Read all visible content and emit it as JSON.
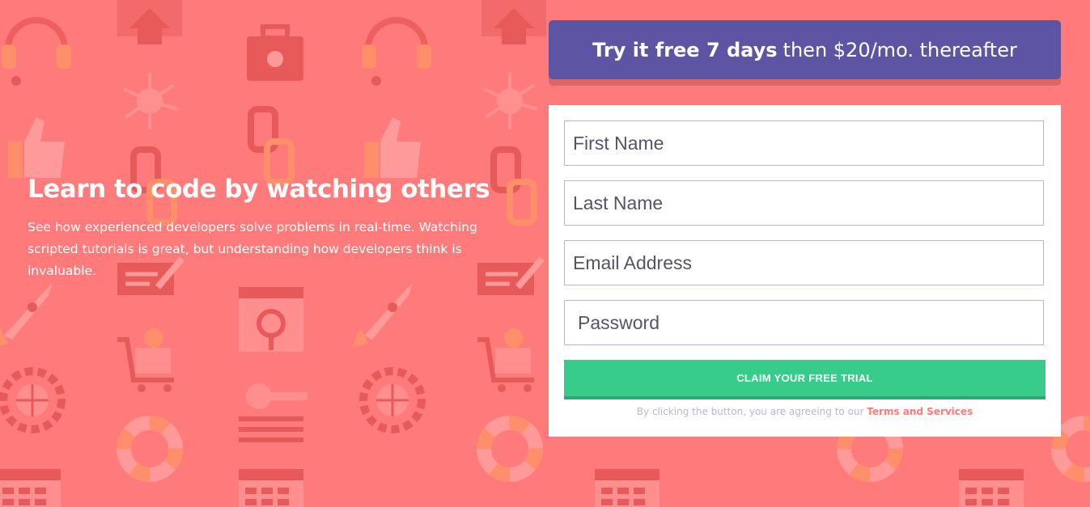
{
  "colors": {
    "background": "#ff7a7a",
    "banner": "#5e54a4",
    "cta": "#38cc8b",
    "field_border": "#b9b6d3",
    "terms_text": "#b9b6d3",
    "terms_link": "#ff7a7a",
    "pattern": "#f56a6a"
  },
  "background_icons": [
    "headset-icon",
    "toolbox-icon",
    "network-icon",
    "thumbs-up-icon",
    "chain-link-icon",
    "message-edit-icon",
    "browser-window-icon",
    "rocket-icon",
    "magnifier-icon",
    "cart-icon",
    "key-icon",
    "globe-gear-icon",
    "life-ring-icon",
    "calendar-icon",
    "home-icon"
  ],
  "hero": {
    "title": "Learn to code by watching others",
    "description": "See how experienced developers solve problems in real-time. Watching scripted tutorials is great, but understanding how developers think is invaluable."
  },
  "banner": {
    "strong": "Try it free 7 days",
    "rest": "then $20/mo. thereafter"
  },
  "form": {
    "first_name_placeholder": "First Name",
    "last_name_placeholder": "Last Name",
    "email_placeholder": "Email Address",
    "password_placeholder": "Password",
    "cta_label": "CLAIM YOUR FREE TRIAL",
    "terms_prefix": "By clicking the button, you are agreeing to our",
    "terms_link": "Terms and Services"
  }
}
